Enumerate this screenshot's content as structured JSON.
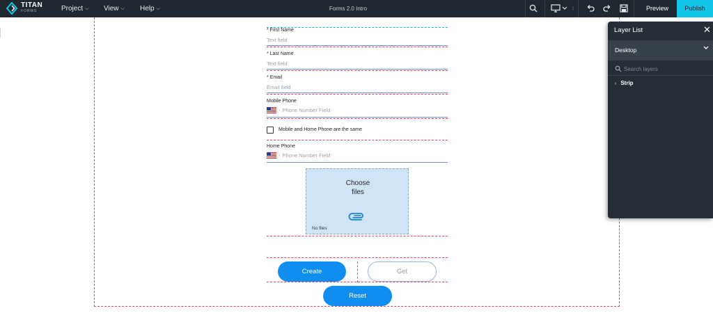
{
  "app": {
    "brand_name": "TITAN",
    "brand_sub": "FORMS",
    "doc_title": "Forms 2.0 Intro",
    "menus": [
      {
        "label": "Project"
      },
      {
        "label": "View"
      },
      {
        "label": "Help"
      }
    ],
    "actions": {
      "preview_label": "Preview",
      "publish_label": "Publish"
    },
    "colors": {
      "topbar": "#1f2730",
      "publish": "#12c7e8",
      "primary_button": "#0f8ef0",
      "guide_dashed": "#e5425a"
    },
    "toolbar_icons": [
      "search-icon",
      "device-desktop-icon",
      "chevron-down-icon",
      "undo-icon",
      "redo-icon",
      "save-icon"
    ]
  },
  "form": {
    "first_name": {
      "label": "* First Name",
      "placeholder": "Text field"
    },
    "last_name": {
      "label": "* Last Name",
      "placeholder": "Text field"
    },
    "email": {
      "label": "* Email",
      "placeholder": "Email field"
    },
    "mobile_phone": {
      "label": "Mobile Phone",
      "placeholder": "Phone Number Field",
      "dash": "-"
    },
    "same_phone_checkbox": {
      "label": "Mobile and Home Phone are the same",
      "checked": false
    },
    "home_phone": {
      "label": "Home Phone",
      "placeholder": "Phone Number Field",
      "dash": "-"
    },
    "upload": {
      "title_line1": "Choose",
      "title_line2": "files",
      "status": "No files",
      "icon": "paperclip-icon"
    },
    "buttons": {
      "create": "Create",
      "get": "Get",
      "reset": "Reset"
    }
  },
  "layer_panel": {
    "title": "Layer List",
    "device": "Desktop",
    "search_placeholder": "Search layers",
    "items": [
      {
        "label": "Strip"
      }
    ]
  }
}
